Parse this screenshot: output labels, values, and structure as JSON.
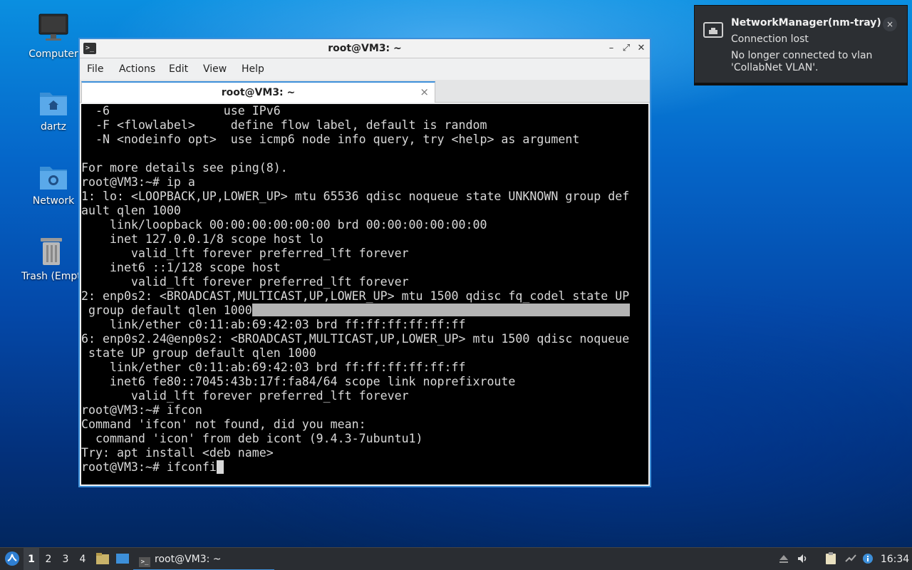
{
  "desktop": {
    "icons": [
      {
        "label": "Computer"
      },
      {
        "label": "dartz"
      },
      {
        "label": "Network"
      },
      {
        "label": "Trash (Empty)"
      }
    ]
  },
  "window": {
    "title": "root@VM3: ~",
    "controls": {
      "minimize": "–",
      "maximize": "⤢",
      "close": "✕"
    },
    "menu": [
      "File",
      "Actions",
      "Edit",
      "View",
      "Help"
    ],
    "tab": {
      "label": "root@VM3: ~",
      "close": "×"
    }
  },
  "terminal": {
    "lines": [
      "  -6                use IPv6",
      "  -F <flowlabel>     define flow label, default is random",
      "  -N <nodeinfo opt>  use icmp6 node info query, try <help> as argument",
      "",
      "For more details see ping(8).",
      "root@VM3:~# ip a",
      "1: lo: <LOOPBACK,UP,LOWER_UP> mtu 65536 qdisc noqueue state UNKNOWN group def",
      "ault qlen 1000",
      "    link/loopback 00:00:00:00:00:00 brd 00:00:00:00:00:00",
      "    inet 127.0.0.1/8 scope host lo",
      "       valid_lft forever preferred_lft forever",
      "    inet6 ::1/128 scope host",
      "       valid_lft forever preferred_lft forever",
      "2: enp0s2: <BROADCAST,MULTICAST,UP,LOWER_UP> mtu 1500 qdisc fq_codel state UP",
      " group default qlen 1000",
      "    link/ether c0:11:ab:69:42:03 brd ff:ff:ff:ff:ff:ff",
      "6: enp0s2.24@enp0s2: <BROADCAST,MULTICAST,UP,LOWER_UP> mtu 1500 qdisc noqueue",
      " state UP group default qlen 1000",
      "    link/ether c0:11:ab:69:42:03 brd ff:ff:ff:ff:ff:ff",
      "    inet6 fe80::7045:43b:17f:fa84/64 scope link noprefixroute",
      "       valid_lft forever preferred_lft forever",
      "root@VM3:~# ifcon",
      "Command 'ifcon' not found, did you mean:",
      "  command 'icon' from deb icont (9.4.3-7ubuntu1)",
      "Try: apt install <deb name>",
      "root@VM3:~# ifconfi"
    ],
    "highlighted_line": 14,
    "cursor_line": 25
  },
  "notification": {
    "app": "NetworkManager(nm-tray)",
    "summary": "Connection lost",
    "body": "No longer connected to vlan 'CollabNet VLAN'.",
    "close": "×"
  },
  "taskbar": {
    "workspaces": [
      "1",
      "2",
      "3",
      "4"
    ],
    "active_workspace": "1",
    "task": "root@VM3: ~",
    "clock": "16:34"
  }
}
